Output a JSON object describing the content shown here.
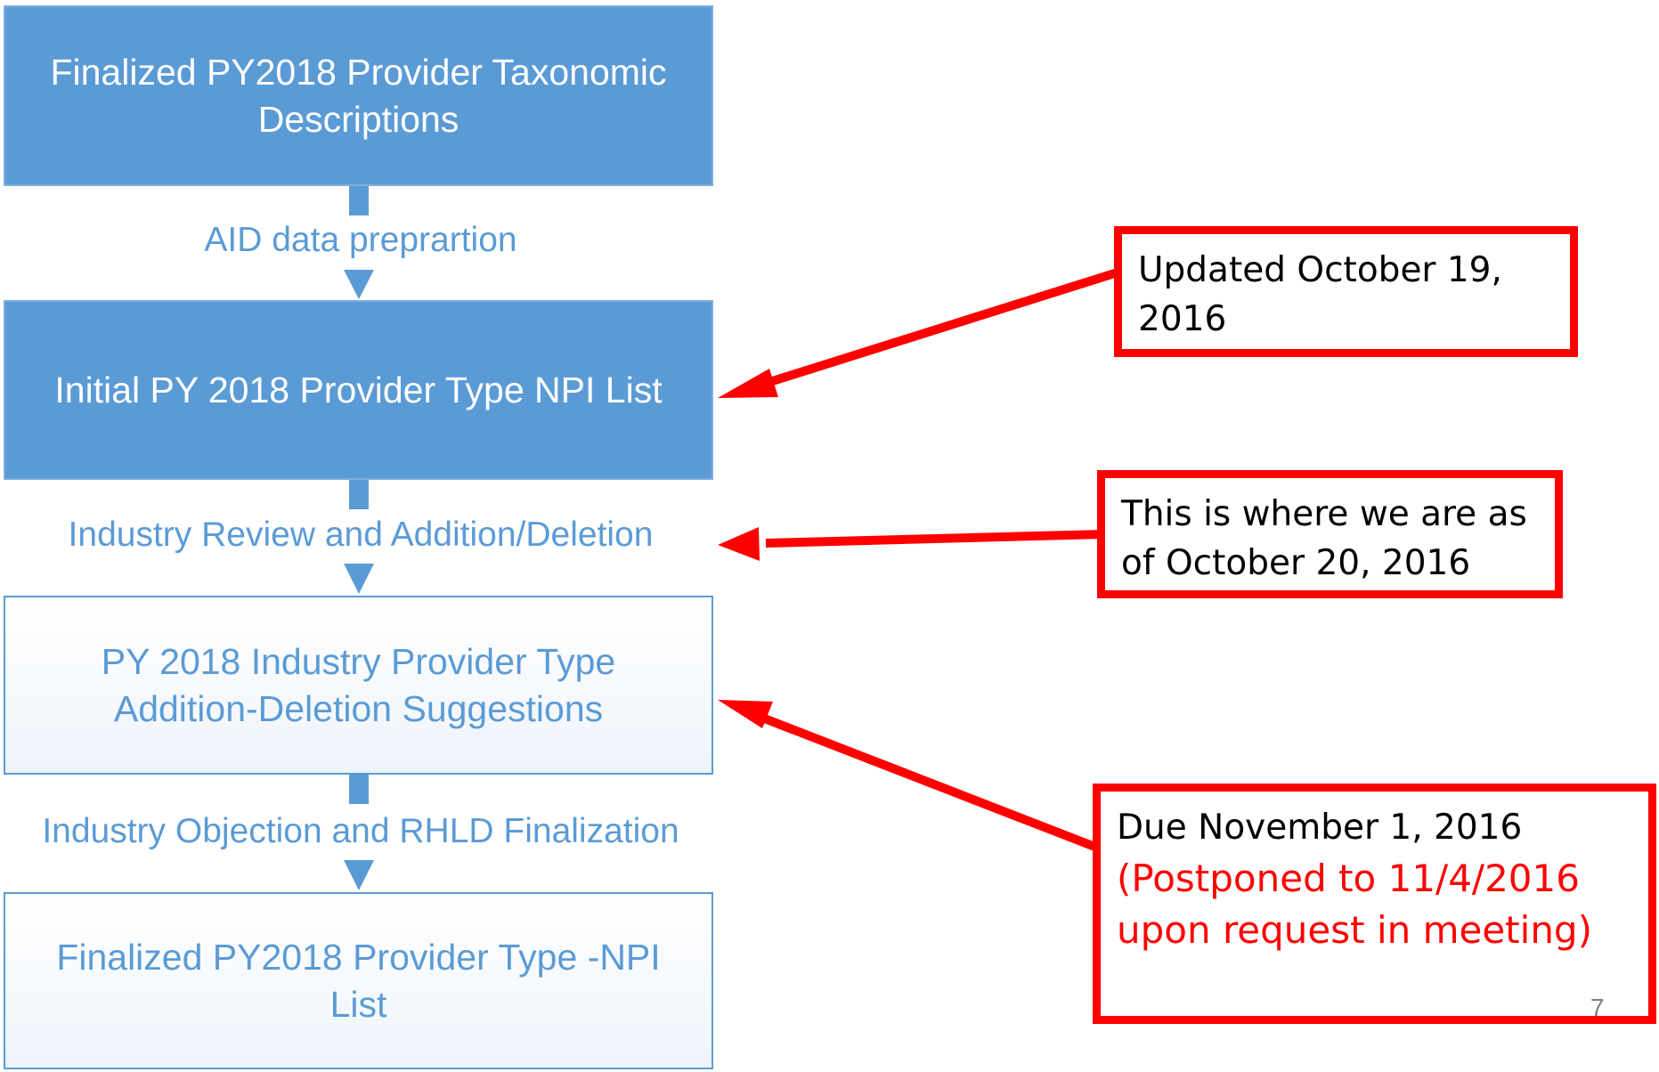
{
  "steps": [
    {
      "label": "Finalized PY2018 Provider Taxonomic Descriptions"
    },
    {
      "label": "Initial PY 2018 Provider Type NPI List"
    },
    {
      "label": "PY 2018 Industry Provider Type Addition-Deletion Suggestions"
    },
    {
      "label": "Finalized PY2018 Provider Type -NPI List"
    }
  ],
  "connectors": [
    {
      "label": "AID data preprartion"
    },
    {
      "label": "Industry Review and Addition/Deletion"
    },
    {
      "label": "Industry Objection and RHLD Finalization"
    }
  ],
  "callouts": [
    {
      "text": "Updated October 19, 2016"
    },
    {
      "text": "This is where we are as of October 20, 2016"
    },
    {
      "text": "Due November 1, 2016",
      "note": "(Postponed to 11/4/2016 upon request in meeting)"
    }
  ],
  "page_number": "7",
  "colors": {
    "box_fill": "#5b9bd5",
    "box_text_light": "#ffffff",
    "connector": "#5b9bd5",
    "callout_border": "#ff0000",
    "arrow": "#ff0000"
  }
}
